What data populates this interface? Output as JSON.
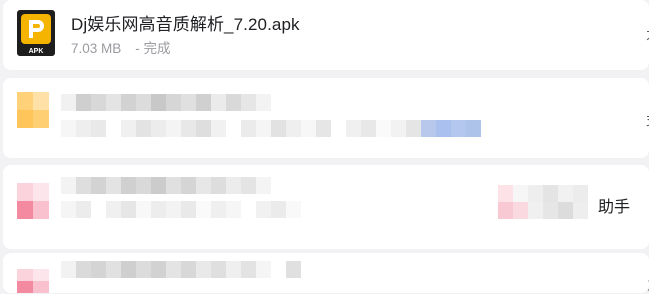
{
  "download": {
    "filename": "Dj娱乐网高音质解析_7.20.apk",
    "size": "7.03 MB",
    "status": "- 完成",
    "icon": "apk-file-icon",
    "icon_label": "APK"
  },
  "partial_text": {
    "row3_suffix": "助手"
  },
  "colors": {
    "accent_apk": "#f5b400",
    "background": "#f2f2f4",
    "card": "#ffffff"
  }
}
